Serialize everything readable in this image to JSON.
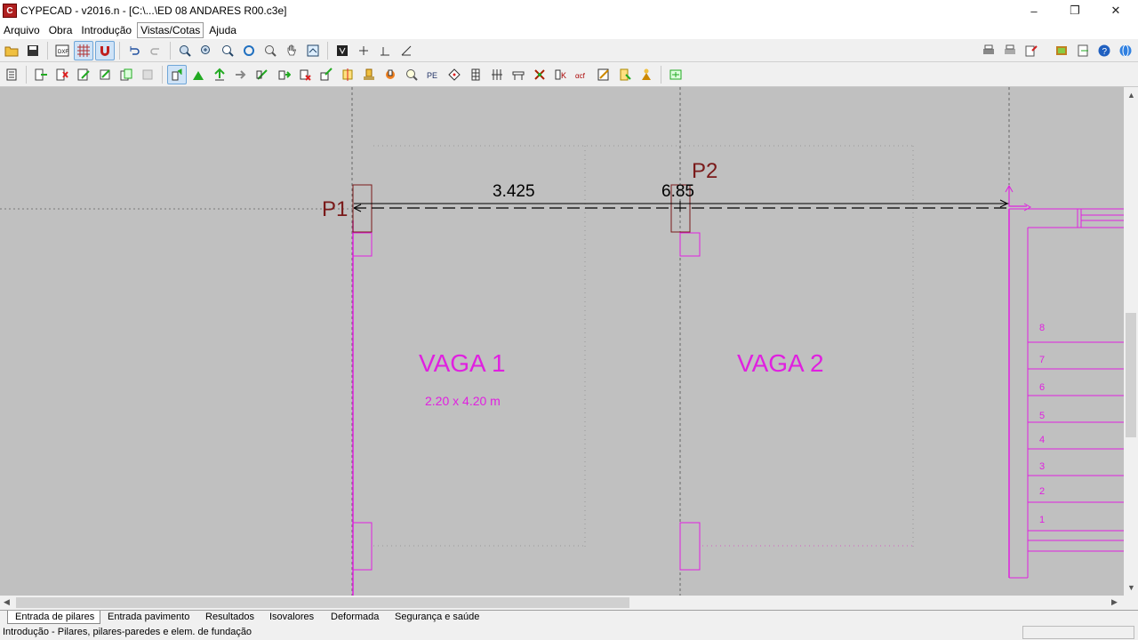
{
  "window": {
    "title": "CYPECAD - v2016.n - [C:\\...\\ED 08 ANDARES R00.c3e]",
    "icon": "cypecad-app-icon",
    "controls": [
      "minimize",
      "restore",
      "close"
    ]
  },
  "menu": [
    "Arquivo",
    "Obra",
    "Introdução",
    "Vistas/Cotas",
    "Ajuda"
  ],
  "menu_active": "Vistas/Cotas",
  "drawing": {
    "pillars": [
      {
        "label": "P1"
      },
      {
        "label": "P2"
      }
    ],
    "dimensions": [
      "3.425",
      "6.85"
    ],
    "spaces": [
      {
        "label": "VAGA 1",
        "size": "2.20 x 4.20 m"
      },
      {
        "label": "VAGA 2"
      }
    ],
    "stair_numbers": [
      "8",
      "7",
      "6",
      "5",
      "4",
      "3",
      "2",
      "1"
    ],
    "colors": {
      "background": "#c0c0c0",
      "magenta": "#e020e0",
      "pillar": "#7a1a1a",
      "dimension_line": "#000000"
    }
  },
  "tabs": [
    "Entrada de pilares",
    "Entrada pavimento",
    "Resultados",
    "Isovalores",
    "Deformada",
    "Segurança e saúde"
  ],
  "tab_active": "Entrada de pilares",
  "status": "Introdução - Pilares, pilares-paredes e elem. de fundação"
}
